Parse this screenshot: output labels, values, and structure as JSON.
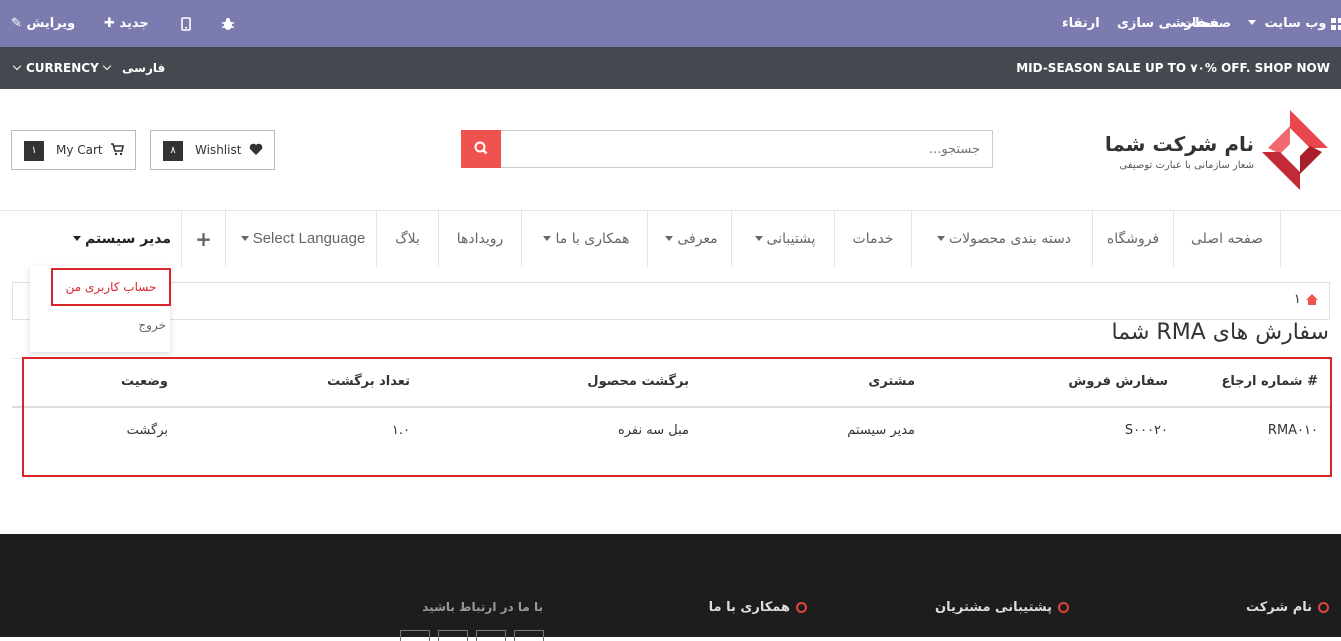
{
  "admin_bar": {
    "edit": "ویرایش",
    "new": "جدید",
    "website": "وب سایت",
    "pages": "صفحات",
    "customize": "سفارشی سازی",
    "upgrade": "ارتقاء"
  },
  "promo_bar": {
    "sale": "MID-SEASON SALE UP TO ۷۰% OFF. SHOP NOW",
    "currency": "CURRENCY",
    "language": "فارسی"
  },
  "header": {
    "company_name": "نام شرکت شما",
    "tagline": "شعار سازمانی با عبارت توصیفی",
    "search_placeholder": "جستجو...",
    "cart_label": "My Cart",
    "cart_count": "۱",
    "wishlist_label": "Wishlist",
    "wishlist_count": "۸"
  },
  "nav": {
    "items": [
      "صفحه اصلی",
      "فروشگاه",
      "دسته بندی محصولات",
      "خدمات",
      "پشتیبانی",
      "معرفی",
      "همکاری با ما",
      "رویدادها",
      "بلاگ",
      "Select Language"
    ],
    "user": "مدیر سیستم"
  },
  "dropdown": {
    "account": "حساب کاربری من",
    "logout": "خروج"
  },
  "breadcrumb": {
    "page": "۱"
  },
  "page_title": "سفارش های RMA شما",
  "table": {
    "headers": [
      "# شماره ارجاع",
      "سفارش فروش",
      "مشتری",
      "برگشت محصول",
      "تعداد برگشت",
      "وضعیت"
    ],
    "rows": [
      [
        "RMA۰۱۰",
        "S۰۰۰۲۰",
        "مدیر سیستم",
        "مبل سه نفره",
        "۱.۰",
        "برگشت"
      ]
    ]
  },
  "footer": {
    "columns": [
      "نام شرکت",
      "پشتیبانی مشتریان",
      "همکاری با ما",
      "با ما در ارتباط باشید"
    ]
  },
  "colors": {
    "admin_bar": "#7b7bb0",
    "accent": "#f0534f",
    "highlight": "#d9252a"
  }
}
